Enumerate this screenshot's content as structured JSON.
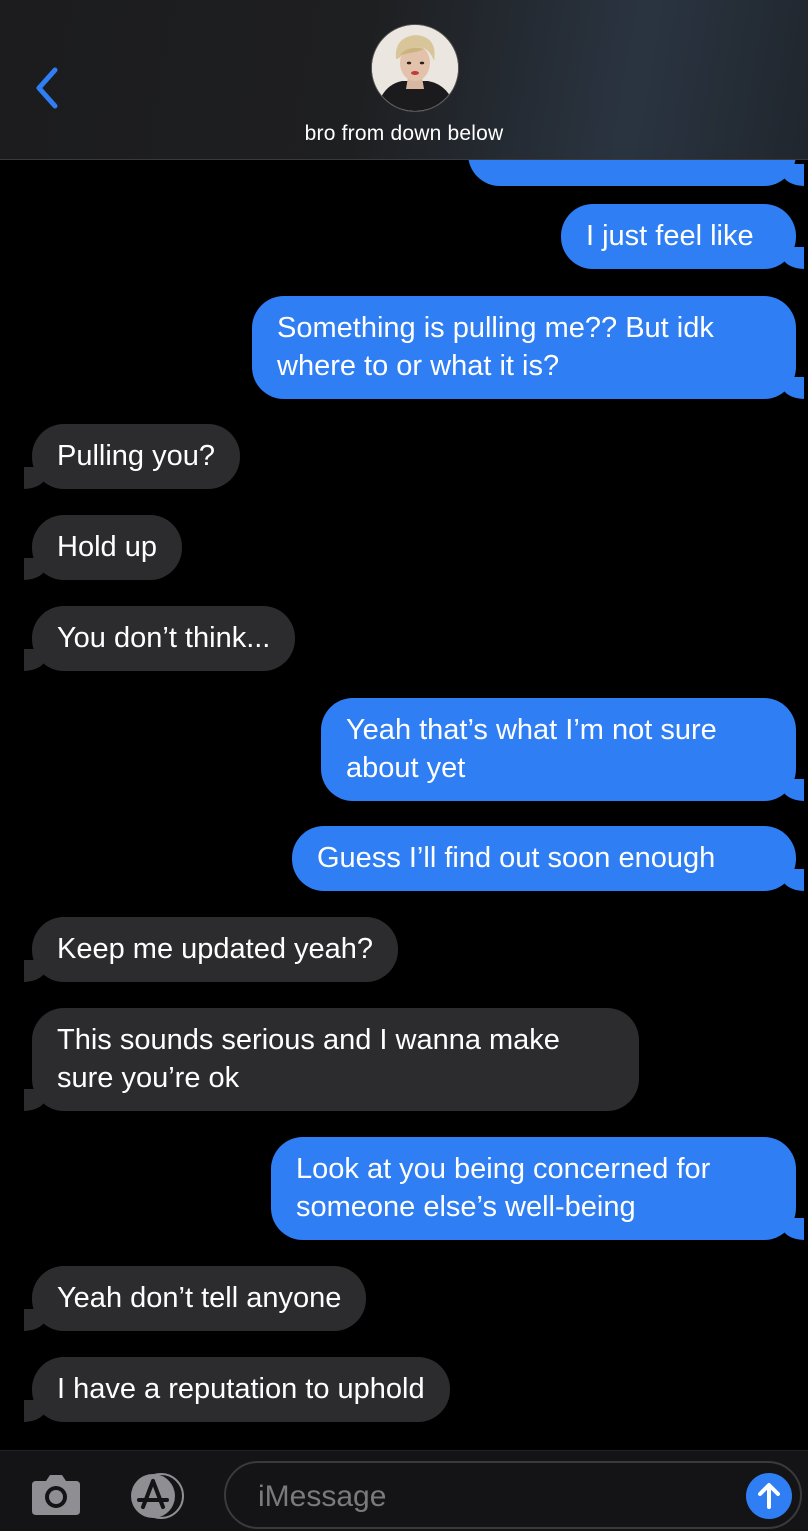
{
  "header": {
    "contact_name": "bro from down below"
  },
  "messages": [
    {
      "direction": "sent",
      "text": "I just feel like"
    },
    {
      "direction": "sent",
      "text": "Something is pulling me?? But idk where to or what it is?"
    },
    {
      "direction": "received",
      "text": "Pulling you?"
    },
    {
      "direction": "received",
      "text": "Hold up"
    },
    {
      "direction": "received",
      "text": "You don’t think..."
    },
    {
      "direction": "sent",
      "text": "Yeah that’s what I’m not sure about yet"
    },
    {
      "direction": "sent",
      "text": "Guess I’ll find out soon enough"
    },
    {
      "direction": "received",
      "text": "Keep me updated yeah?"
    },
    {
      "direction": "received",
      "text": "This sounds serious and I wanna make sure you’re ok"
    },
    {
      "direction": "sent",
      "text": "Look at you being concerned for someone else’s well-being"
    },
    {
      "direction": "received",
      "text": "Yeah don’t tell anyone"
    },
    {
      "direction": "received",
      "text": "I have a reputation to uphold"
    }
  ],
  "compose": {
    "placeholder": "iMessage"
  },
  "colors": {
    "sent_bubble": "#2f7ef4",
    "received_bubble": "#2c2c2e",
    "accent": "#2f7ef4",
    "background": "#000000"
  },
  "icons": {
    "back": "chevron-left-icon",
    "camera": "camera-icon",
    "apps": "app-store-icon",
    "send": "arrow-up-icon"
  }
}
